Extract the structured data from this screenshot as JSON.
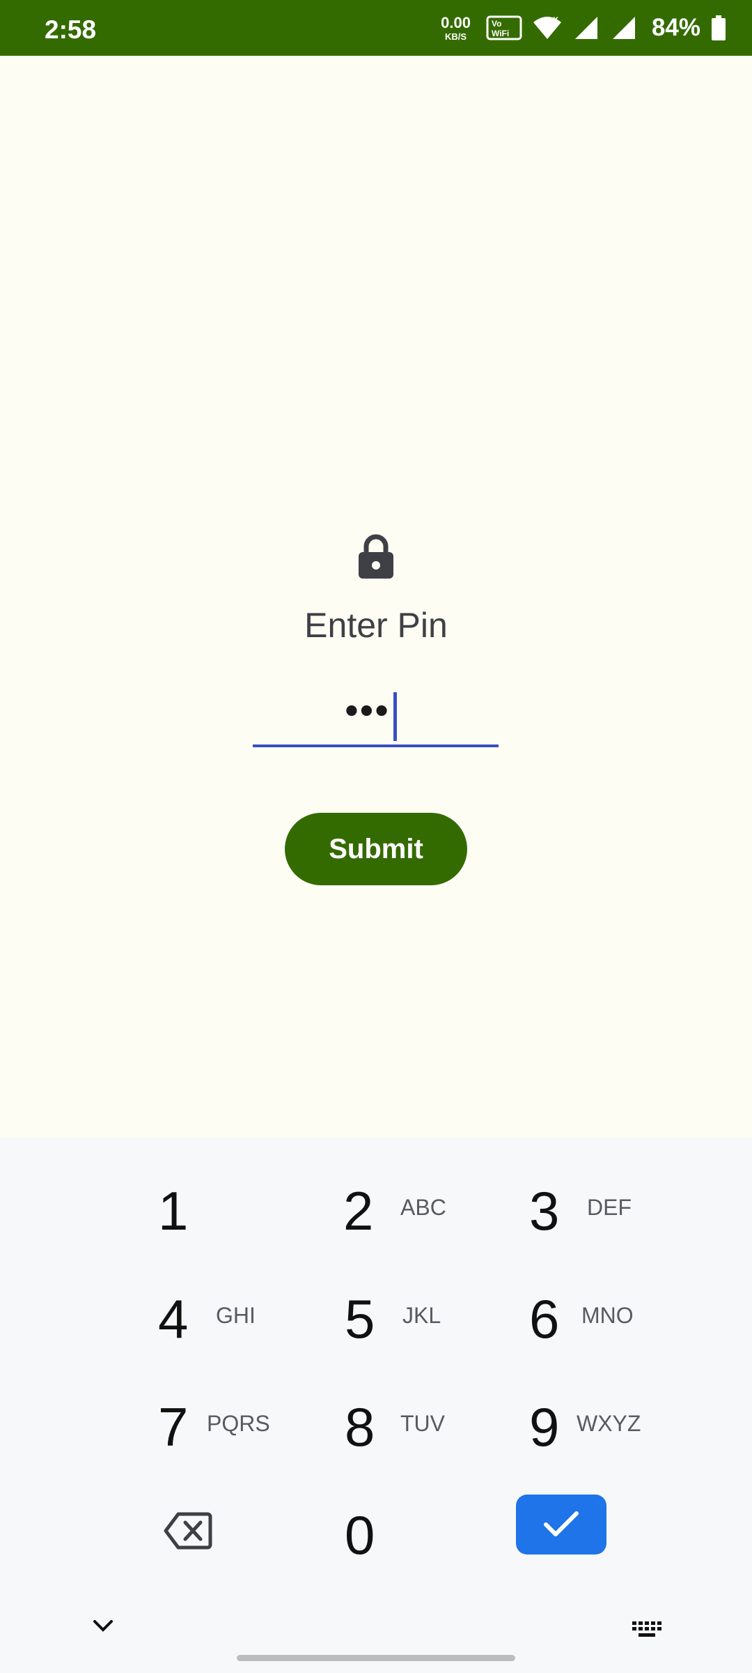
{
  "status_bar": {
    "time": "2:58",
    "net_speed_value": "0.00",
    "net_speed_unit": "KB/S",
    "vowifi_label": "VoWiFi",
    "battery_percent": "84%",
    "bar_color": "#346B00",
    "icons": [
      "vowifi-icon",
      "wifi-icon",
      "signal-icon",
      "signal-icon",
      "battery-icon"
    ]
  },
  "pin_screen": {
    "icon": "lock-icon",
    "title": "Enter Pin",
    "pin_value": "•••",
    "submit_label": "Submit",
    "accent_color": "#346B00",
    "field_color": "#3A4FC3"
  },
  "keypad": {
    "keys": [
      {
        "digit": "1",
        "letters": ""
      },
      {
        "digit": "2",
        "letters": "ABC"
      },
      {
        "digit": "3",
        "letters": "DEF"
      },
      {
        "digit": "4",
        "letters": "GHI"
      },
      {
        "digit": "5",
        "letters": "JKL"
      },
      {
        "digit": "6",
        "letters": "MNO"
      },
      {
        "digit": "7",
        "letters": "PQRS"
      },
      {
        "digit": "8",
        "letters": "TUV"
      },
      {
        "digit": "9",
        "letters": "WXYZ"
      },
      {
        "digit": "0",
        "letters": ""
      }
    ],
    "done_color": "#1E74E8",
    "icons": [
      "backspace-icon",
      "check-icon",
      "chevron-down-icon",
      "keyboard-icon"
    ]
  }
}
